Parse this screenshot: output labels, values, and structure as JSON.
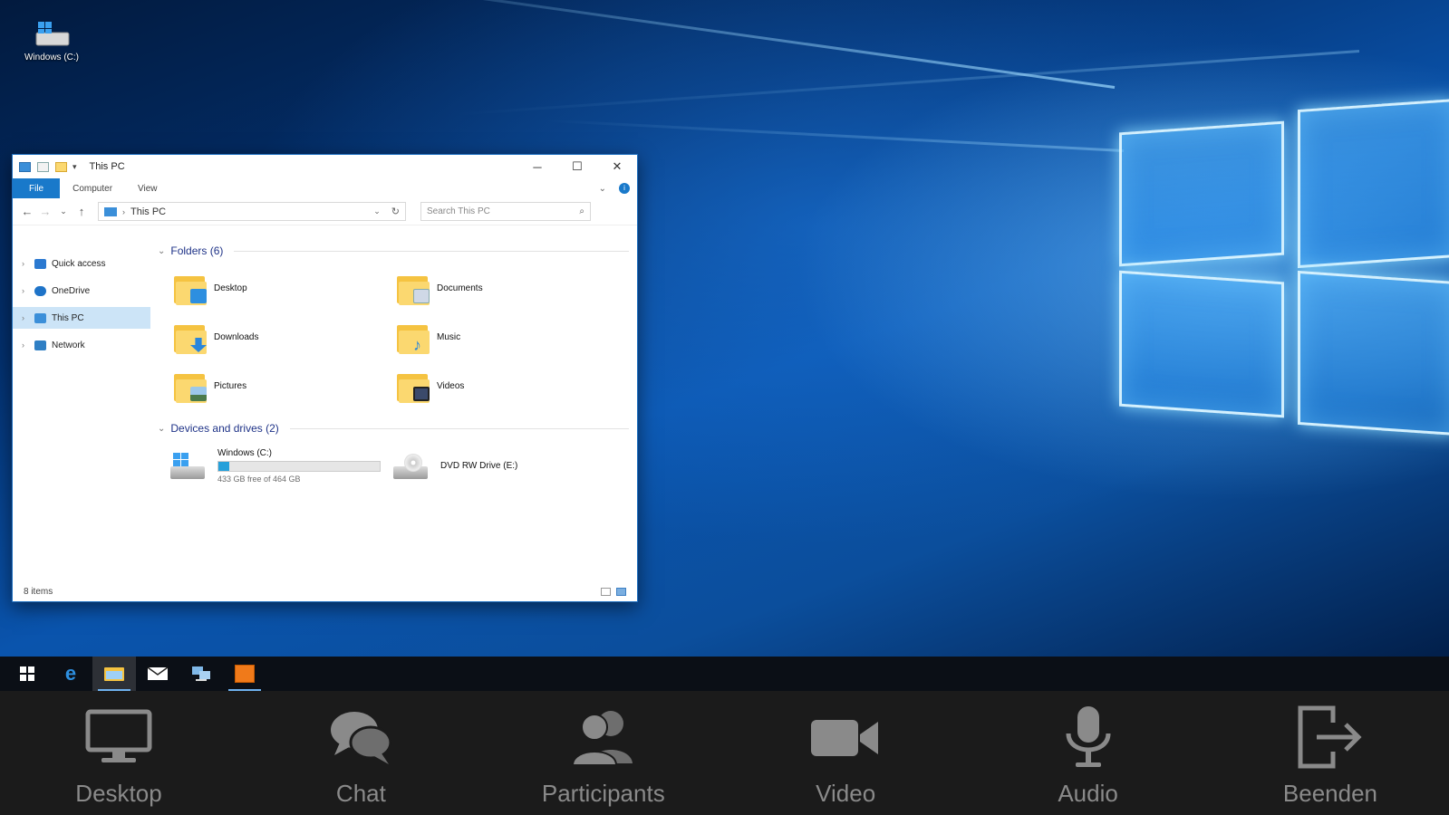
{
  "desktop": {
    "icon_label": "Windows (C:)"
  },
  "explorer": {
    "title": "This PC",
    "window_controls": {
      "minimize": "─",
      "maximize": "☐",
      "close": "✕"
    },
    "ribbon_tabs": [
      "File",
      "Computer",
      "View"
    ],
    "address": "This PC",
    "search_placeholder": "Search This PC",
    "nav_pane": [
      {
        "label": "Quick access",
        "color": "#2b79d0"
      },
      {
        "label": "OneDrive",
        "color": "#1e73c8"
      },
      {
        "label": "This PC",
        "color": "#3b8fd9",
        "selected": true
      },
      {
        "label": "Network",
        "color": "#2f7fc4"
      }
    ],
    "folders_header": "Folders (6)",
    "folders": [
      {
        "label": "Desktop",
        "badge_color": "#2d8fe0"
      },
      {
        "label": "Documents",
        "badge_color": "#cfd8e6"
      },
      {
        "label": "Downloads",
        "badge_color": "#2a86db"
      },
      {
        "label": "Music",
        "badge_color": "#2a86db"
      },
      {
        "label": "Pictures",
        "badge_color": "#7fb2d8"
      },
      {
        "label": "Videos",
        "badge_color": "#3b4a6b"
      }
    ],
    "drives_header": "Devices and drives (2)",
    "drives": [
      {
        "label": "Windows (C:)",
        "free_text": "433 GB free of 464 GB",
        "used_fraction": 0.07
      },
      {
        "label": "DVD RW Drive (E:)"
      }
    ],
    "status": "8 items"
  },
  "taskbar": {
    "items": [
      "start-icon",
      "edge-icon",
      "file-explorer-icon",
      "mail-icon",
      "network-icon",
      "app-icon"
    ],
    "active_item": "file-explorer-icon"
  },
  "controls": [
    {
      "label": "Desktop",
      "icon": "monitor-icon"
    },
    {
      "label": "Chat",
      "icon": "chat-icon"
    },
    {
      "label": "Participants",
      "icon": "participants-icon"
    },
    {
      "label": "Video",
      "icon": "video-camera-icon"
    },
    {
      "label": "Audio",
      "icon": "microphone-icon"
    },
    {
      "label": "Beenden",
      "icon": "leave-icon"
    }
  ],
  "colors": {
    "accent": "#1979ca",
    "control_bar": "#1b1b1b",
    "control_label": "#8a8a8a"
  }
}
